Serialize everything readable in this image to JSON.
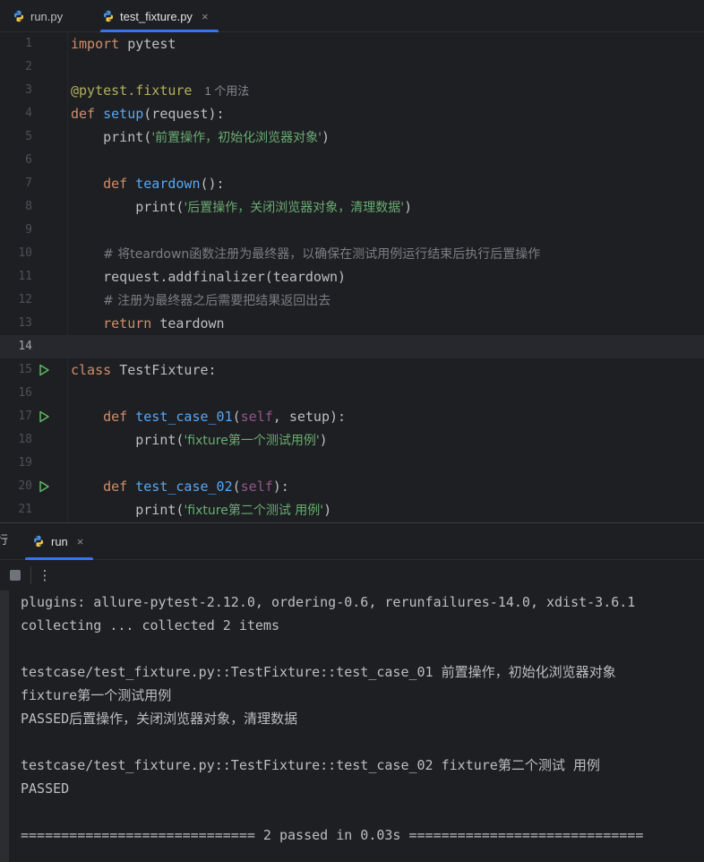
{
  "tabs": [
    {
      "label": "run.py",
      "active": false,
      "icon": "python-icon"
    },
    {
      "label": "test_fixture.py",
      "active": true,
      "icon": "python-icon",
      "close": "×"
    }
  ],
  "editor": {
    "current_line": 14,
    "lines": [
      {
        "n": "1",
        "tokens": [
          [
            "kw",
            "import"
          ],
          [
            "txt",
            " pytest"
          ]
        ]
      },
      {
        "n": "2",
        "tokens": []
      },
      {
        "n": "3",
        "tokens": [
          [
            "dec",
            "@pytest.fixture"
          ]
        ],
        "hint": "1 个用法"
      },
      {
        "n": "4",
        "tokens": [
          [
            "kw",
            "def "
          ],
          [
            "fn",
            "setup"
          ],
          [
            "txt",
            "(request):"
          ]
        ]
      },
      {
        "n": "5",
        "tokens": [
          [
            "txt",
            "    print("
          ],
          [
            "str",
            "'前置操作，初始化浏览器对象'"
          ],
          [
            "txt",
            ")"
          ]
        ]
      },
      {
        "n": "6",
        "tokens": []
      },
      {
        "n": "7",
        "tokens": [
          [
            "txt",
            "    "
          ],
          [
            "kw",
            "def "
          ],
          [
            "fn",
            "teardown"
          ],
          [
            "txt",
            "():"
          ]
        ]
      },
      {
        "n": "8",
        "tokens": [
          [
            "txt",
            "        print("
          ],
          [
            "str",
            "'后置操作，关闭浏览器对象，清理数据'"
          ],
          [
            "txt",
            ")"
          ]
        ]
      },
      {
        "n": "9",
        "tokens": []
      },
      {
        "n": "10",
        "tokens": [
          [
            "txt",
            "    "
          ],
          [
            "cm",
            "# 将teardown函数注册为最终器，以确保在测试用例运行结束后执行后置操作"
          ]
        ]
      },
      {
        "n": "11",
        "tokens": [
          [
            "txt",
            "    request.addfinalizer(teardown)"
          ]
        ]
      },
      {
        "n": "12",
        "tokens": [
          [
            "txt",
            "    "
          ],
          [
            "cm",
            "# 注册为最终器之后需要把结果返回出去"
          ]
        ]
      },
      {
        "n": "13",
        "tokens": [
          [
            "txt",
            "    "
          ],
          [
            "kw",
            "return"
          ],
          [
            "txt",
            " teardown"
          ]
        ]
      },
      {
        "n": "14",
        "tokens": []
      },
      {
        "n": "15",
        "tokens": [
          [
            "kw",
            "class "
          ],
          [
            "txt",
            "TestFixture:"
          ]
        ],
        "run": true
      },
      {
        "n": "16",
        "tokens": []
      },
      {
        "n": "17",
        "tokens": [
          [
            "txt",
            "    "
          ],
          [
            "kw",
            "def "
          ],
          [
            "fn",
            "test_case_01"
          ],
          [
            "txt",
            "("
          ],
          [
            "self",
            "self"
          ],
          [
            "txt",
            ", setup):"
          ]
        ],
        "run": true
      },
      {
        "n": "18",
        "tokens": [
          [
            "txt",
            "        print("
          ],
          [
            "str",
            "'fixture第一个测试用例'"
          ],
          [
            "txt",
            ")"
          ]
        ]
      },
      {
        "n": "19",
        "tokens": []
      },
      {
        "n": "20",
        "tokens": [
          [
            "txt",
            "    "
          ],
          [
            "kw",
            "def "
          ],
          [
            "fn",
            "test_case_02"
          ],
          [
            "txt",
            "("
          ],
          [
            "self",
            "self"
          ],
          [
            "txt",
            "):"
          ]
        ],
        "run": true
      },
      {
        "n": "21",
        "tokens": [
          [
            "txt",
            "        print("
          ],
          [
            "str",
            "'fixture第二个测试 用例'"
          ],
          [
            "txt",
            ")"
          ]
        ]
      }
    ]
  },
  "panel": {
    "title": "行",
    "run_tab": {
      "label": "run",
      "close": "×"
    },
    "more_label": "⋮"
  },
  "console": {
    "lines": [
      "plugins: allure-pytest-2.12.0, ordering-0.6, rerunfailures-14.0, xdist-3.6.1",
      "collecting ... collected 2 items",
      "",
      "testcase/test_fixture.py::TestFixture::test_case_01 前置操作，初始化浏览器对象",
      "fixture第一个测试用例",
      "PASSED后置操作，关闭浏览器对象，清理数据",
      "",
      "testcase/test_fixture.py::TestFixture::test_case_02 fixture第二个测试 用例",
      "PASSED",
      "",
      "============================= 2 passed in 0.03s ============================="
    ]
  },
  "colors": {
    "background": "#1e1f22",
    "accent": "#3574f0",
    "keyword": "#cf8e6d",
    "function": "#56a8f5",
    "string": "#6aab73",
    "comment": "#7a7e85",
    "decorator": "#b3ae60",
    "run_green": "#5fb865"
  }
}
